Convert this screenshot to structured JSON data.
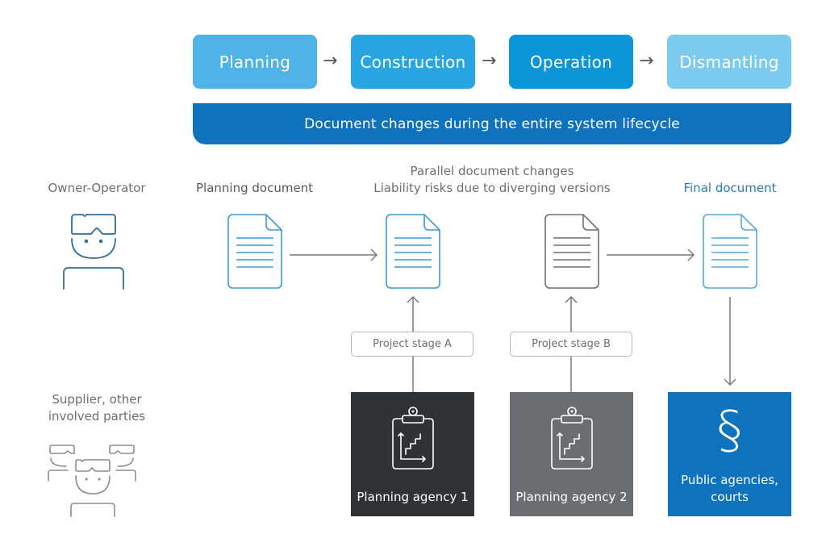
{
  "phases": [
    {
      "label": "Planning",
      "color": "#4fb3e8"
    },
    {
      "label": "Construction",
      "color": "#28a6e3"
    },
    {
      "label": "Operation",
      "color": "#0b96d9"
    },
    {
      "label": "Dismantling",
      "color": "#7ccbef"
    }
  ],
  "phase_arrow": "→",
  "banner": {
    "label": "Document changes during the entire system lifecycle",
    "color": "#0f72bd"
  },
  "roles": {
    "owner_operator": "Owner-Operator",
    "supplier_line1": "Supplier, other",
    "supplier_line2": "involved parties"
  },
  "documents": {
    "planning": "Planning document",
    "parallel_line1": "Parallel document changes",
    "parallel_line2": "Liability risks due to diverging versions",
    "final": "Final document",
    "final_color": "#2b7bb5"
  },
  "stages": [
    "Project stage A",
    "Project stage B"
  ],
  "agencies": [
    {
      "label": "Planning agency 1",
      "color": "#2f3338"
    },
    {
      "label": "Planning agency 2",
      "color": "#6a6e72"
    }
  ],
  "public": {
    "line1": "Public agencies,",
    "line2": "courts",
    "symbol": "§",
    "color": "#0f72bd"
  }
}
